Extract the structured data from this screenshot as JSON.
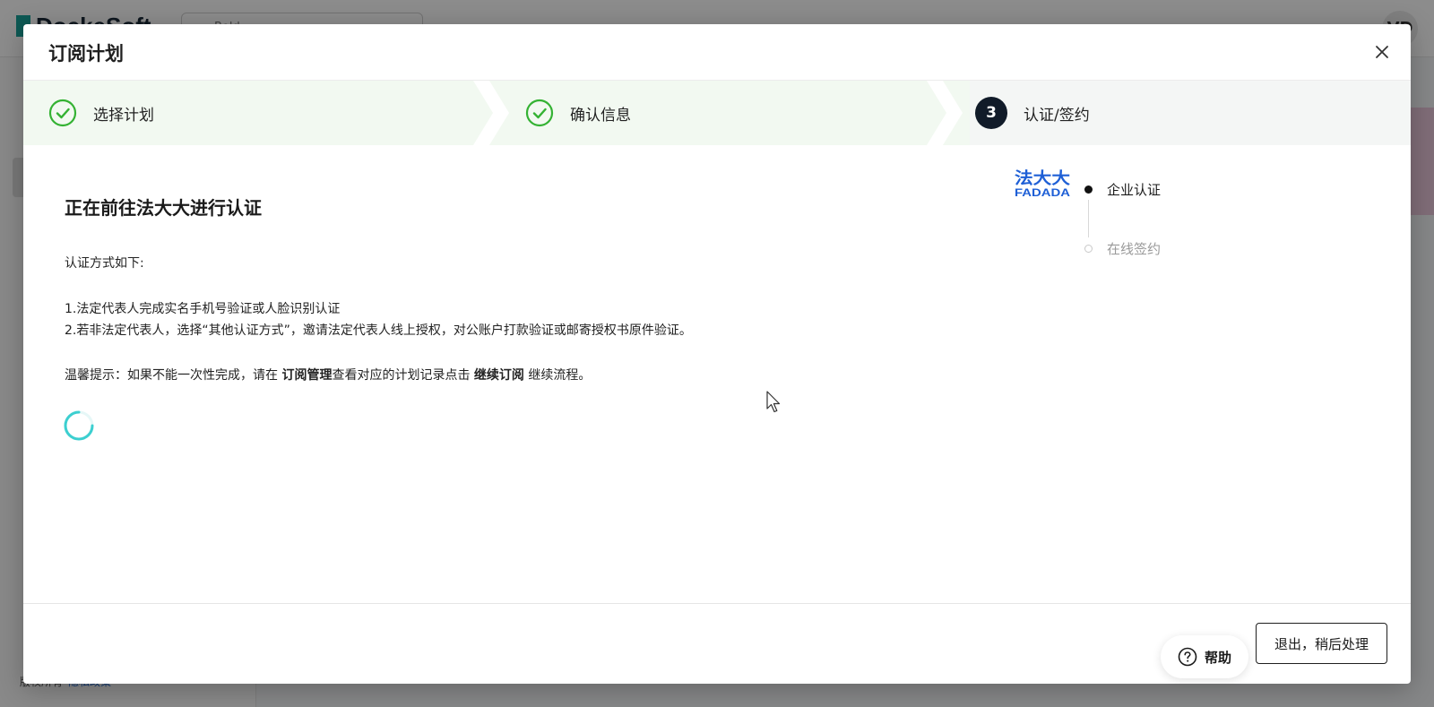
{
  "background": {
    "logo_text": "DockeSoft",
    "search_placeholder": "Bold ...",
    "avatar_initials": "VD",
    "footer_text": "版权所有",
    "footer_link": "隐私政策"
  },
  "modal": {
    "title": "订阅计划",
    "close_icon": "close-icon",
    "steps": [
      {
        "label": "选择计划",
        "status": "done"
      },
      {
        "label": "确认信息",
        "status": "done"
      },
      {
        "number": "3",
        "label": "认证/签约",
        "status": "current"
      }
    ],
    "content": {
      "heading": "正在前往法大大进行认证",
      "method_intro": "认证方式如下:",
      "method_1": "1.法定代表人完成实名手机号验证或人脸识别认证",
      "method_2": "2.若非法定代表人，选择“其他认证方式”，邀请法定代表人线上授权，对公账户打款验证或邮寄授权书原件验证。",
      "tip_prefix": "温馨提示：如果不能一次性完成，请在 ",
      "tip_link1": "订阅管理",
      "tip_middle": "查看对应的计划记录点击 ",
      "tip_link2": "继续订阅",
      "tip_suffix": " 继续流程。"
    },
    "fadada_logo": {
      "top_text": "法大大",
      "bottom_text": "FADADA",
      "color": "#1e5fd6"
    },
    "sub_steps": [
      {
        "label": "企业认证",
        "active": true
      },
      {
        "label": "在线签约",
        "active": false
      }
    ],
    "footer": {
      "exit_button": "退出，稍后处理"
    }
  },
  "help": {
    "label": "帮助",
    "icon": "question-circle-icon"
  },
  "colors": {
    "success_green": "#34b233",
    "spinner": "#3ccfd0",
    "step_bg_done": "#f2f9f1",
    "step_number_bg": "#111b29"
  }
}
